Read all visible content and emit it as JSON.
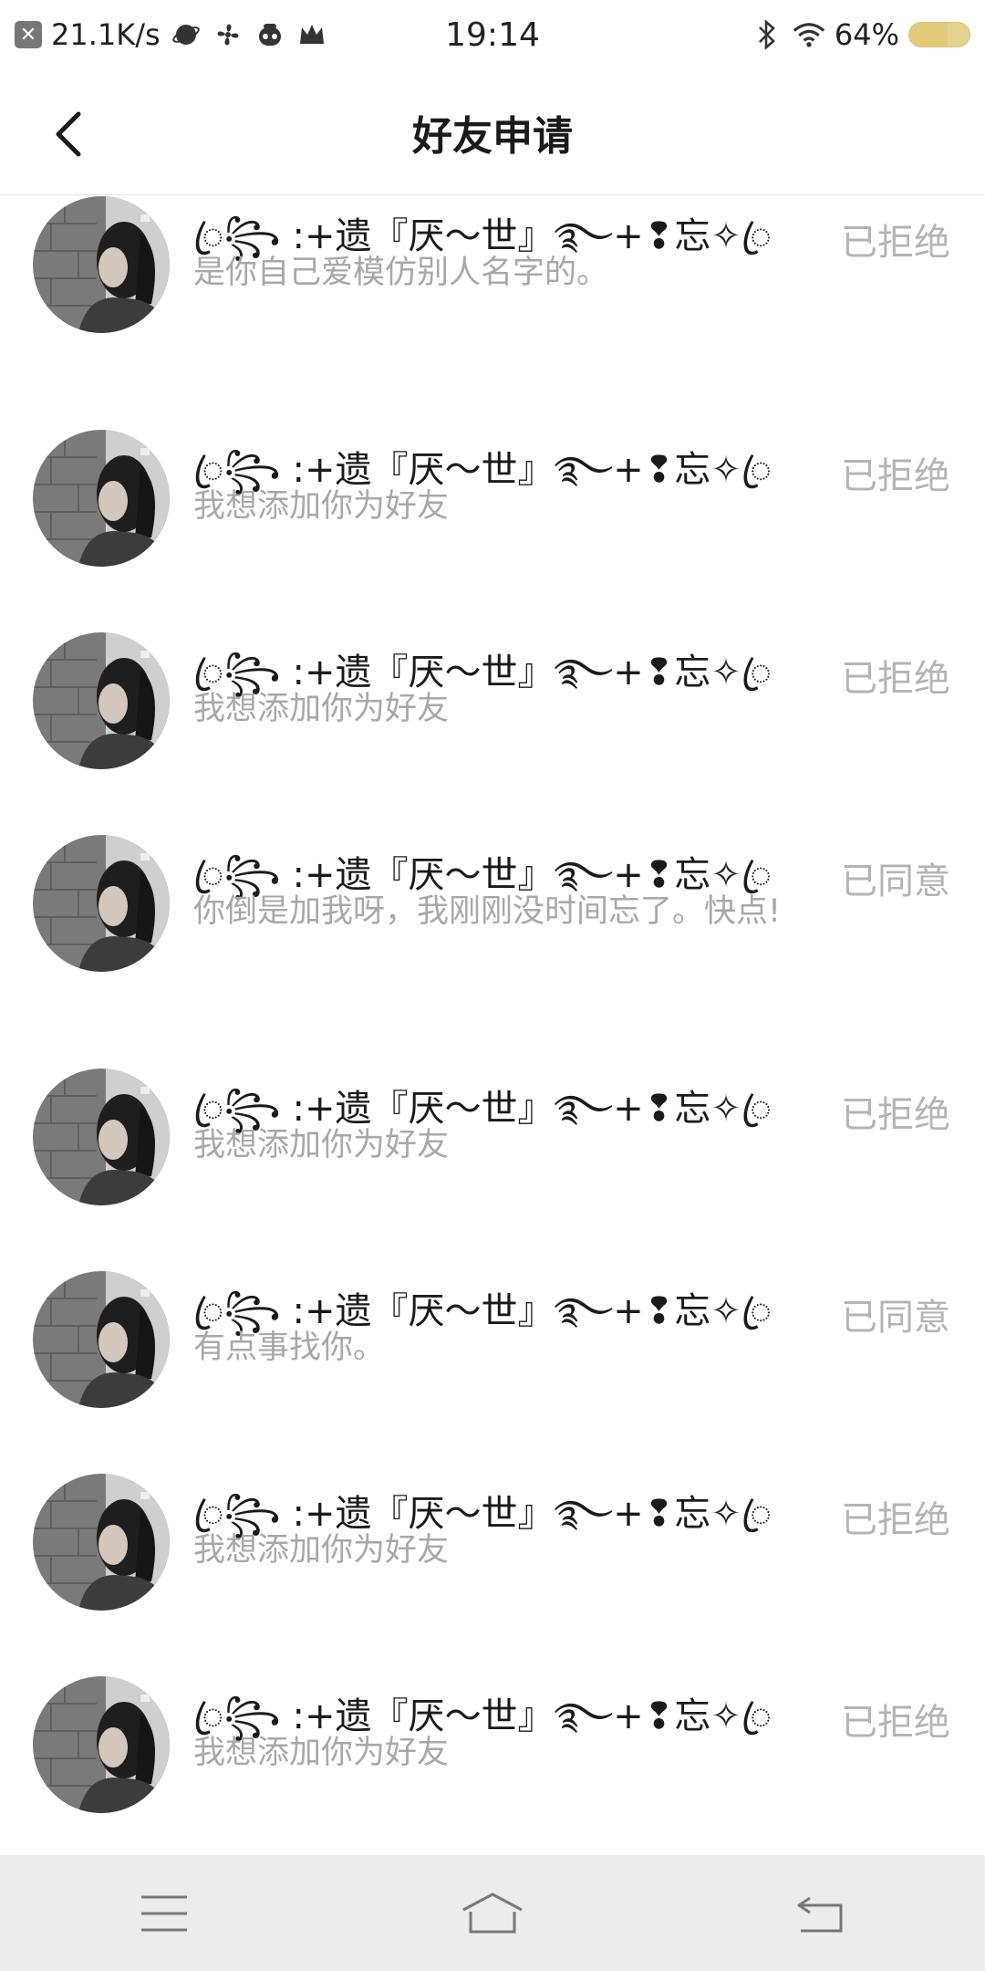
{
  "status_bar": {
    "speed": "21.1K/s",
    "time": "19:14",
    "battery_text": "64%",
    "battery_level": 0.64,
    "battery_color": "#e4d38e"
  },
  "header": {
    "title": "好友申请",
    "back_icon": "chevron-left-icon"
  },
  "requests": [
    {
      "name": "ꦿ꧂ :+遗『厌～世』࿐+❢忘✧ꦿ",
      "message": "是你自己爱模仿别人名字的。",
      "status": "已拒绝"
    },
    {
      "name": "ꦿ꧂ :+遗『厌～世』࿐+❢忘✧ꦿ",
      "message": "我想添加你为好友",
      "status": "已拒绝"
    },
    {
      "name": "ꦿ꧂ :+遗『厌～世』࿐+❢忘✧ꦿ",
      "message": "我想添加你为好友",
      "status": "已拒绝"
    },
    {
      "name": "ꦿ꧂ :+遗『厌～世』࿐+❢忘✧ꦿ",
      "message": "你倒是加我呀，我刚刚没时间忘了。快点!",
      "status": "已同意"
    },
    {
      "name": "ꦿ꧂ :+遗『厌～世』࿐+❢忘✧ꦿ",
      "message": "我想添加你为好友",
      "status": "已拒绝"
    },
    {
      "name": "ꦿ꧂ :+遗『厌～世』࿐+❢忘✧ꦿ",
      "message": "有点事找你。",
      "status": "已同意"
    },
    {
      "name": "ꦿ꧂ :+遗『厌～世』࿐+❢忘✧ꦿ",
      "message": "我想添加你为好友",
      "status": "已拒绝"
    },
    {
      "name": "ꦿ꧂ :+遗『厌～世』࿐+❢忘✧ꦿ",
      "message": "我想添加你为好友",
      "status": "已拒绝"
    }
  ],
  "nav_bar": {
    "menu_icon": "menu-icon",
    "home_icon": "home-icon",
    "back_icon": "back-icon"
  }
}
